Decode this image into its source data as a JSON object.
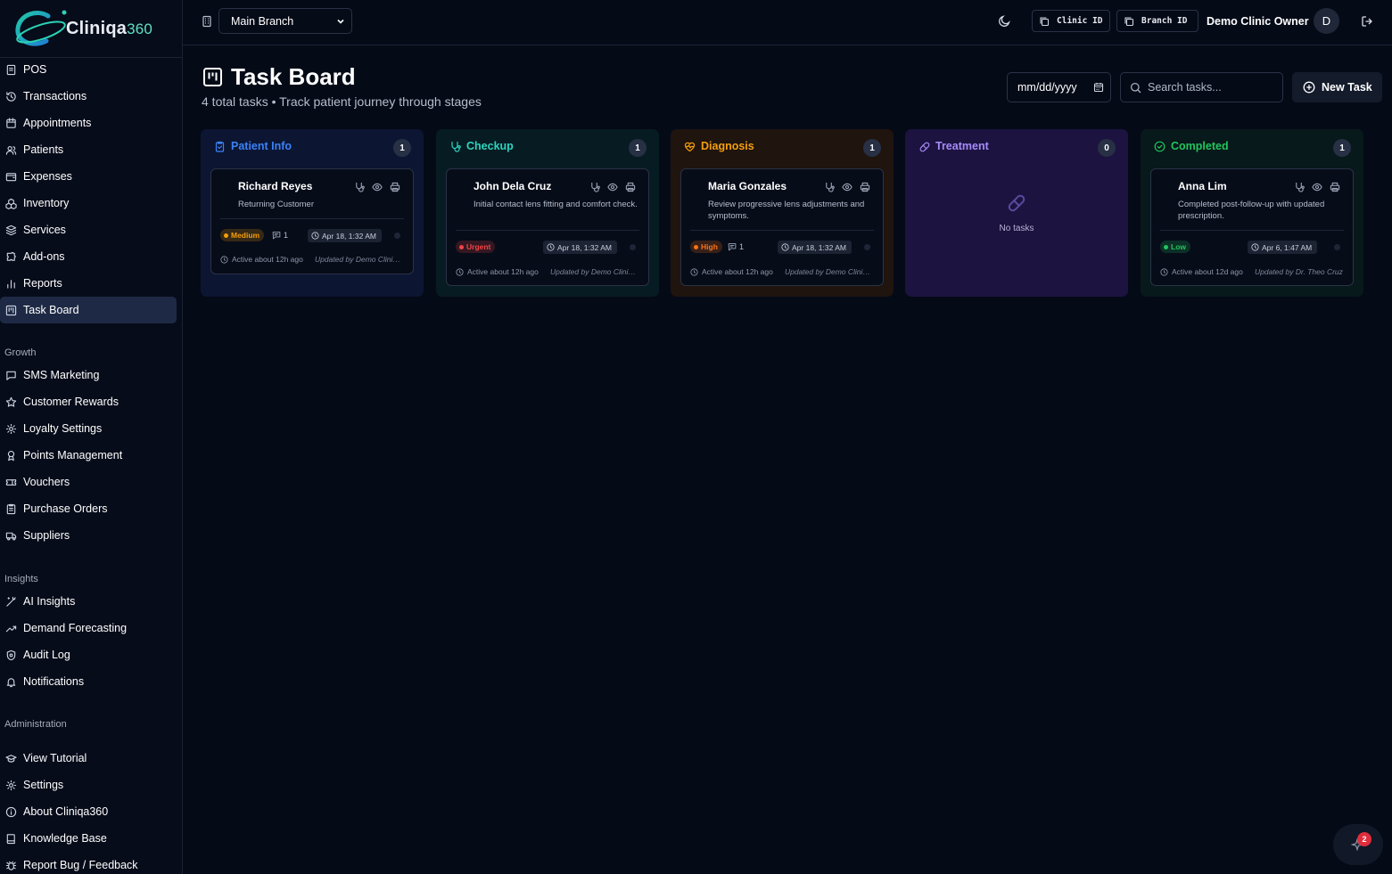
{
  "brand": {
    "name": "Cliniqa",
    "suffix": "360"
  },
  "sidebar": {
    "main": [
      "POS",
      "Transactions",
      "Appointments",
      "Patients",
      "Expenses",
      "Inventory",
      "Services",
      "Add-ons",
      "Reports",
      "Task Board"
    ],
    "growth_title": "Growth",
    "growth": [
      "SMS Marketing",
      "Customer Rewards",
      "Loyalty Settings",
      "Points Management",
      "Vouchers",
      "Purchase Orders",
      "Suppliers"
    ],
    "insights_title": "Insights",
    "insights": [
      "AI Insights",
      "Demand Forecasting",
      "Audit Log",
      "Notifications"
    ],
    "admin_title": "Administration",
    "admin": [
      "View Tutorial",
      "Settings",
      "About Cliniqa360",
      "Knowledge Base",
      "Report Bug / Feedback"
    ]
  },
  "topbar": {
    "branch": "Main Branch",
    "clinic_id_label": "Clinic ID",
    "branch_id_label": "Branch ID",
    "owner": "Demo Clinic Owner",
    "avatar": "D"
  },
  "header": {
    "title": "Task Board",
    "subtitle": "4 total tasks • Track patient journey through stages",
    "date_placeholder": "mm/dd/yyyy",
    "search_placeholder": "Search tasks...",
    "new_task": "New Task"
  },
  "columns": [
    {
      "title": "Patient Info",
      "count": "1",
      "color": "#3b82f6",
      "bg": "#0c1633",
      "card": {
        "name": "Richard Reyes",
        "desc": "Returning Customer",
        "priority": "Medium",
        "priority_color": "#f59e0b",
        "comments": "1",
        "due": "Apr 18, 1:32 AM",
        "active": "Active about 12h ago",
        "updated": "Updated by Demo Clinic Owner"
      }
    },
    {
      "title": "Checkup",
      "count": "1",
      "color": "#2dd4bf",
      "bg": "#071c22",
      "card": {
        "name": "John Dela Cruz",
        "desc": "Initial contact lens fitting and comfort check.",
        "priority": "Urgent",
        "priority_color": "#ef4444",
        "comments": "",
        "due": "Apr 18, 1:32 AM",
        "active": "Active about 12h ago",
        "updated": "Updated by Demo Clinic Owner"
      }
    },
    {
      "title": "Diagnosis",
      "count": "1",
      "color": "#f59e0b",
      "bg": "#1f140e",
      "card": {
        "name": "Maria Gonzales",
        "desc": "Review progressive lens adjustments and symptoms.",
        "priority": "High",
        "priority_color": "#f97316",
        "comments": "1",
        "due": "Apr 18, 1:32 AM",
        "active": "Active about 12h ago",
        "updated": "Updated by Demo Clinic Owner"
      }
    },
    {
      "title": "Treatment",
      "count": "0",
      "color": "#a78bfa",
      "bg": "#1c1340",
      "empty": "No tasks"
    },
    {
      "title": "Completed",
      "count": "1",
      "color": "#22c55e",
      "bg": "#07191a",
      "card": {
        "name": "Anna Lim",
        "desc": "Completed post-follow-up with updated prescription.",
        "priority": "Low",
        "priority_color": "#22c55e",
        "comments": "",
        "due": "Apr 6, 1:47 AM",
        "active": "Active about 12d ago",
        "updated": "Updated by Dr. Theo Cruz"
      }
    }
  ],
  "fab": {
    "count": "2"
  }
}
